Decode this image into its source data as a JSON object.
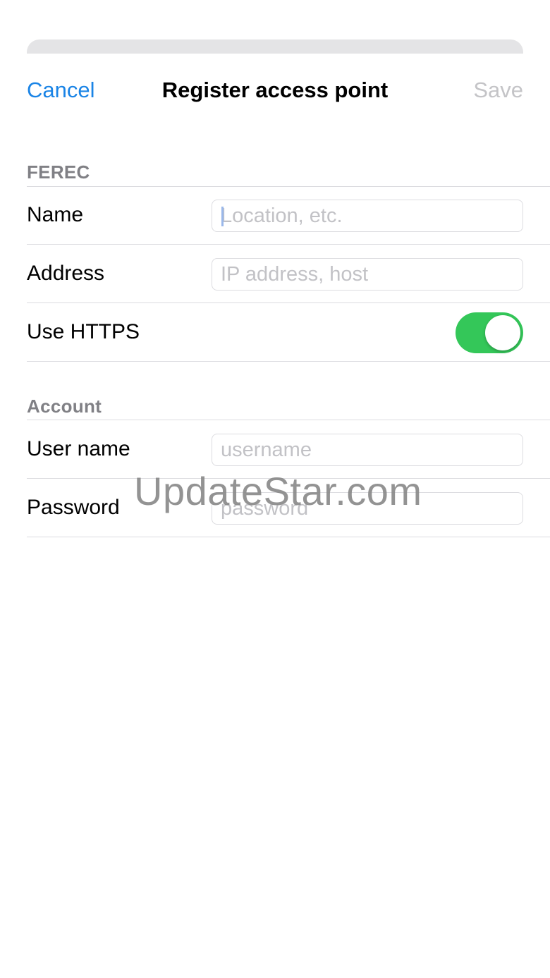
{
  "navbar": {
    "cancel_label": "Cancel",
    "title": "Register access point",
    "save_label": "Save"
  },
  "sections": {
    "ferec": {
      "header": "FEREC",
      "name_label": "Name",
      "name_placeholder": "Location, etc.",
      "address_label": "Address",
      "address_placeholder": "IP address, host",
      "https_label": "Use HTTPS",
      "https_enabled": true
    },
    "account": {
      "header": "Account",
      "username_label": "User name",
      "username_placeholder": "username",
      "password_label": "Password",
      "password_placeholder": "password"
    }
  },
  "watermark": "UpdateStar.com",
  "colors": {
    "accent": "#1a84e6",
    "toggle_on": "#34c759",
    "disabled_text": "#c4c4c7",
    "section_header": "#808085"
  }
}
